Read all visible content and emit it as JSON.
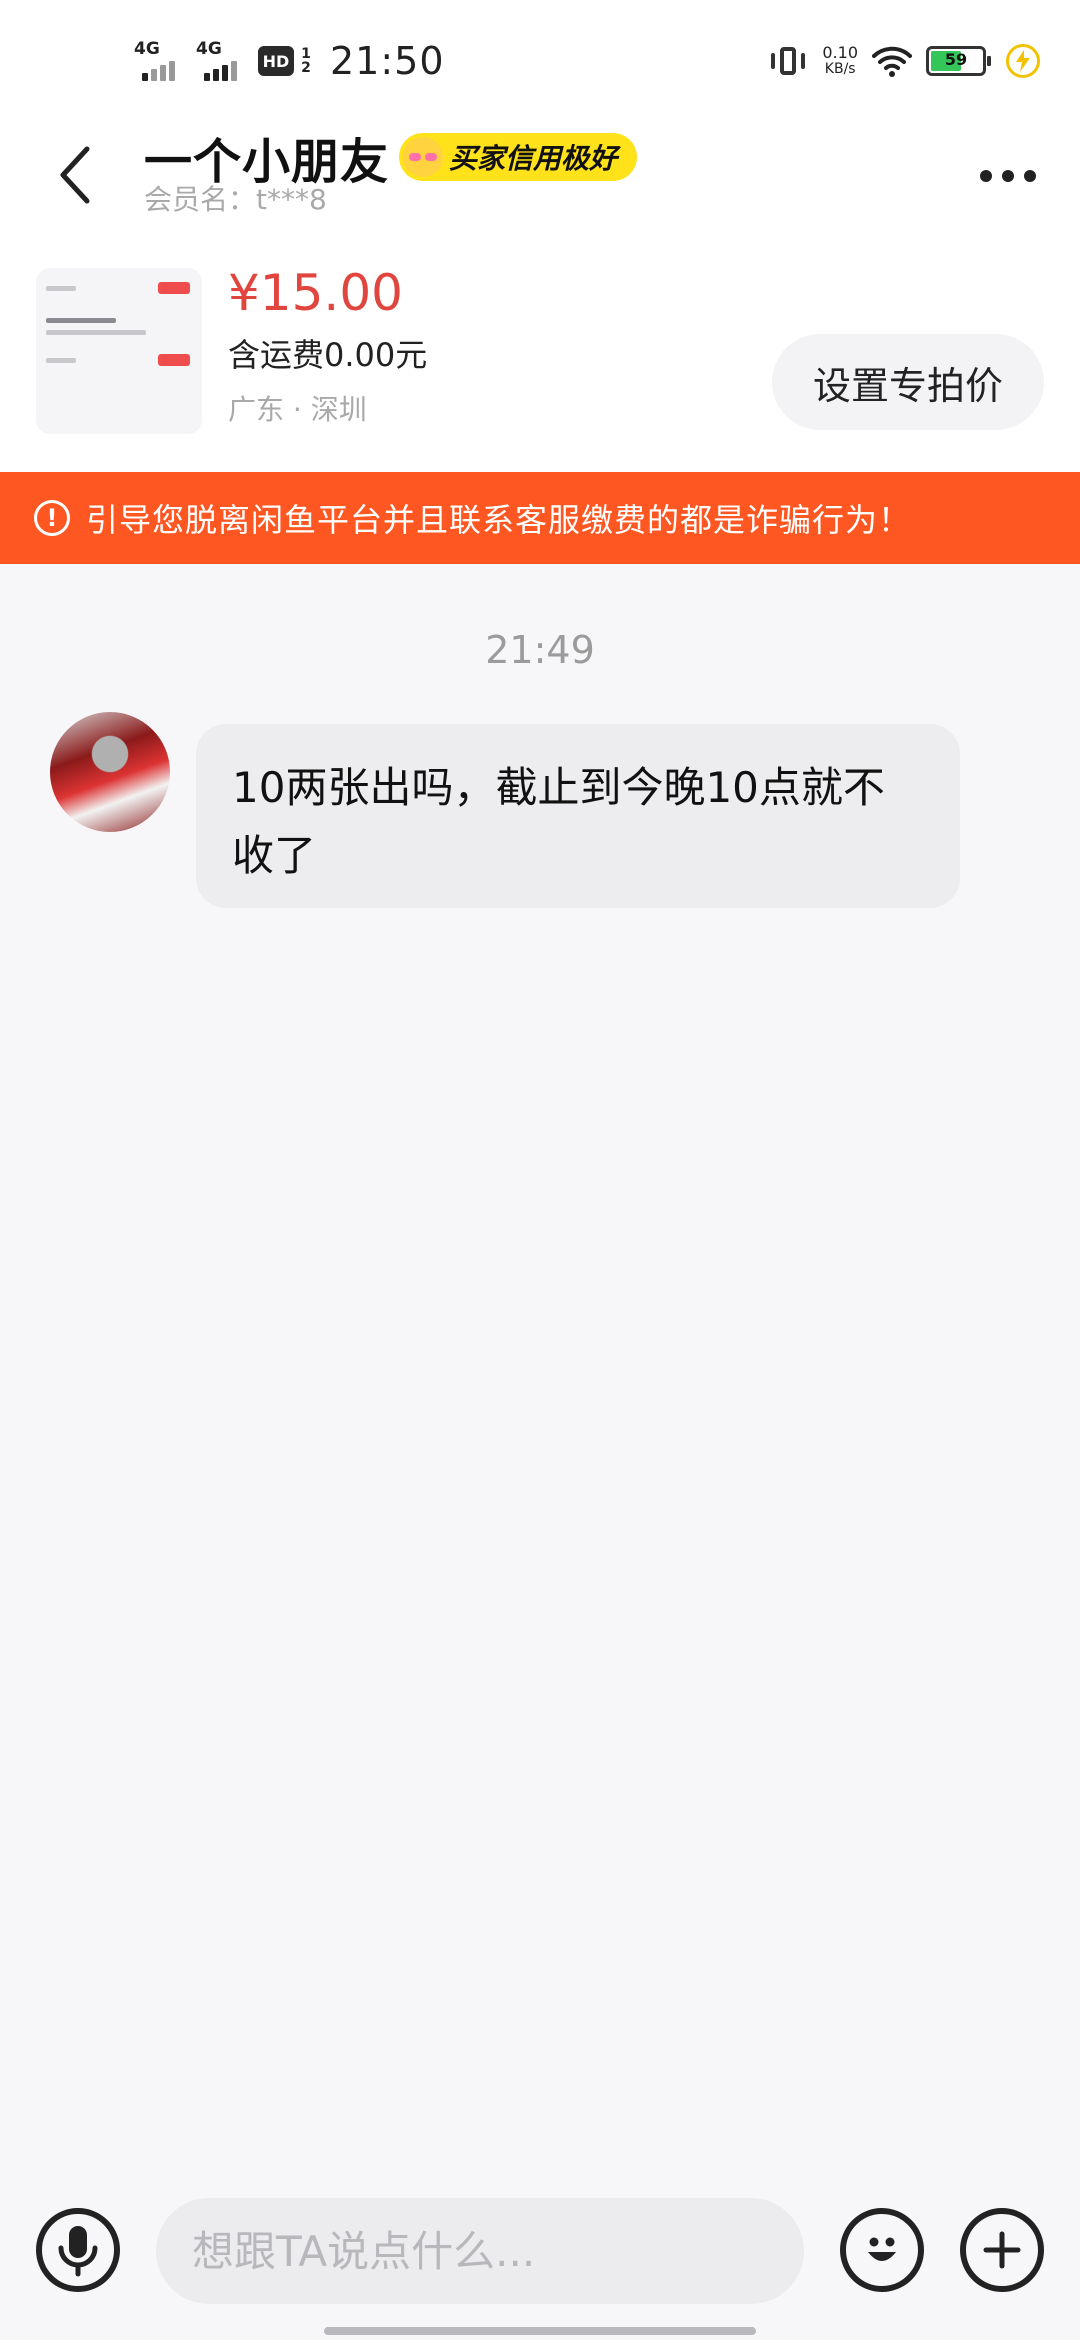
{
  "status_bar": {
    "signal1_label": "4G",
    "signal2_label": "4G",
    "hd_label": "HD",
    "hd_sub": "1 2",
    "time": "21:50",
    "net_speed_value": "0.10",
    "net_speed_unit": "KB/s",
    "battery_level": "59"
  },
  "header": {
    "title": "一个小朋友",
    "credit_badge": "买家信用极好",
    "member_label": "会员名：t***8"
  },
  "product": {
    "price": "¥15.00",
    "shipping": "含运费0.00元",
    "location": "广东 · 深圳",
    "special_price_button": "设置专拍价"
  },
  "warning": {
    "icon": "!",
    "text": "引导您脱离闲鱼平台并且联系客服缴费的都是诈骗行为！"
  },
  "chat": {
    "time": "21:49",
    "messages": [
      {
        "text": "10两张出吗，截止到今晚10点就不收了"
      }
    ]
  },
  "input": {
    "placeholder": "想跟TA说点什么..."
  },
  "colors": {
    "price": "#e0453e",
    "warning_bg": "#ff5722",
    "credit_badge_bg": "#ffe21a",
    "battery_fill": "#35c659"
  }
}
